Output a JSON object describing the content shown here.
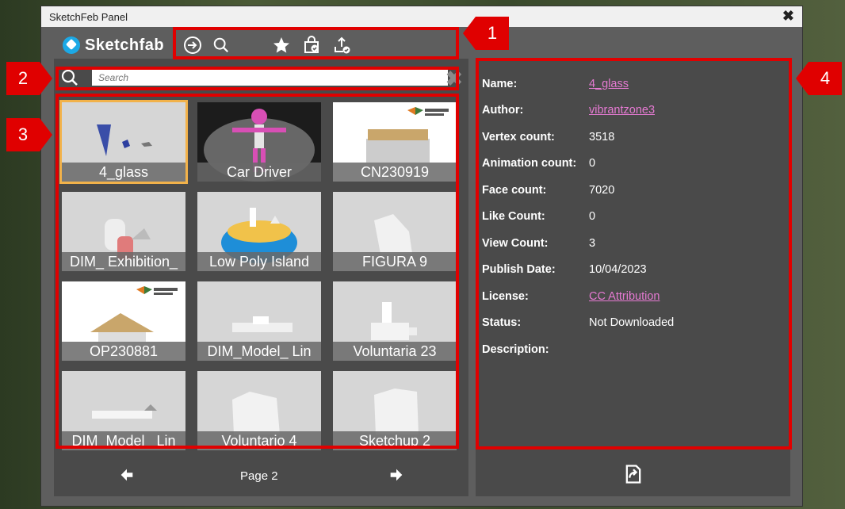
{
  "window": {
    "title": "SketchFeb Panel",
    "close_glyph": "✖"
  },
  "brand": {
    "name": "Sketchfab",
    "color": "#1ca9e6"
  },
  "toolbar": {
    "icons": [
      "login-icon",
      "search-icon",
      "star-icon",
      "purchases-icon",
      "upload-icon"
    ]
  },
  "search": {
    "placeholder": "Search",
    "clear_glyph": "✖"
  },
  "grid": {
    "tiles": [
      {
        "caption": "4_glass",
        "selected": true
      },
      {
        "caption": "Car Driver"
      },
      {
        "caption": "CN230919"
      },
      {
        "caption": "DIM_ Exhibition_"
      },
      {
        "caption": "Low Poly Island"
      },
      {
        "caption": "FIGURA 9"
      },
      {
        "caption": "OP230881"
      },
      {
        "caption": "DIM_Model_ Lin"
      },
      {
        "caption": "Voluntaria 23"
      },
      {
        "caption": "DIM_Model_ Lin"
      },
      {
        "caption": "Voluntario 4"
      },
      {
        "caption": "Sketchup 2"
      }
    ]
  },
  "pager": {
    "page_label": "Page 2"
  },
  "details": {
    "rows": [
      {
        "key": "Name:",
        "value": "4_glass",
        "link": true
      },
      {
        "key": "Author:",
        "value": "vibrantzone3",
        "link": true
      },
      {
        "key": "Vertex count:",
        "value": "3518"
      },
      {
        "key": "Animation count:",
        "value": "0"
      },
      {
        "key": "Face count:",
        "value": "7020"
      },
      {
        "key": "Like Count:",
        "value": "0"
      },
      {
        "key": "View Count:",
        "value": "3"
      },
      {
        "key": "Publish Date:",
        "value": "10/04/2023"
      },
      {
        "key": "License:",
        "value": "CC Attribution",
        "link": true
      },
      {
        "key": "Status:",
        "value": "Not Downloaded"
      },
      {
        "key": "Description:",
        "value": ""
      }
    ]
  },
  "callouts": [
    "1",
    "2",
    "3",
    "4"
  ],
  "colors": {
    "accent_selected": "#f2b24a",
    "link": "#e57ad2",
    "callout": "#e00000"
  }
}
